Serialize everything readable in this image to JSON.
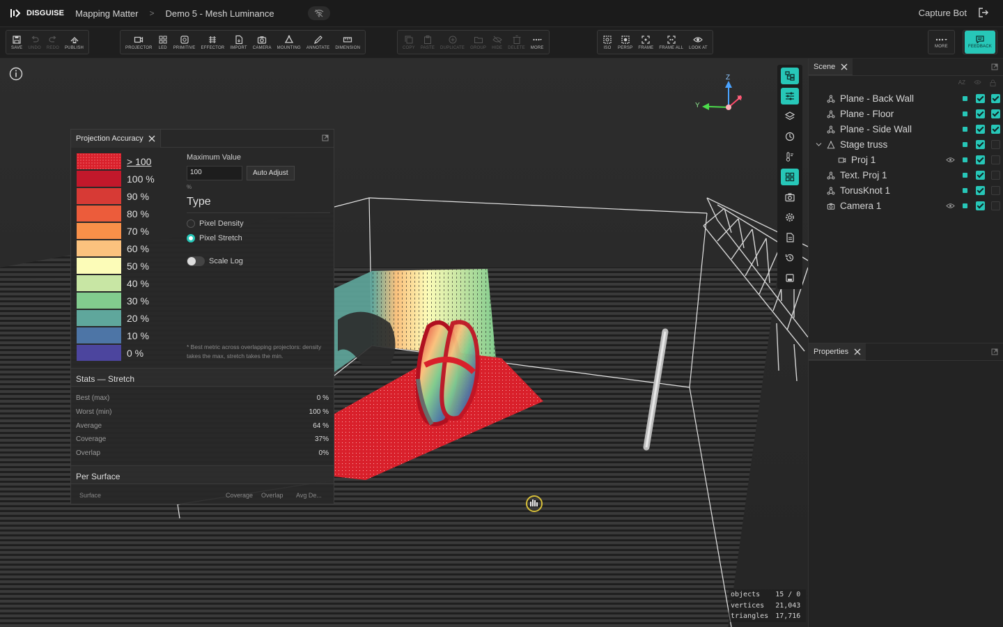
{
  "topbar": {
    "brand": "DISGUISE",
    "project": "Mapping Matter",
    "separator": ">",
    "scene_name": "Demo 5 - Mesh Luminance",
    "user": "Capture Bot"
  },
  "toolbar": {
    "groups": [
      [
        {
          "label": "SAVE",
          "icon": "save-icon",
          "enabled": true
        },
        {
          "label": "UNDO",
          "icon": "undo-icon",
          "enabled": false
        },
        {
          "label": "REDO",
          "icon": "redo-icon",
          "enabled": false
        },
        {
          "label": "PUBLISH",
          "icon": "publish-icon",
          "enabled": true
        }
      ],
      [
        {
          "label": "PROJECTOR",
          "icon": "projector-icon",
          "enabled": true
        },
        {
          "label": "LED",
          "icon": "led-icon",
          "enabled": true
        },
        {
          "label": "PRIMITIVE",
          "icon": "primitive-icon",
          "enabled": true
        },
        {
          "label": "EFFECTOR",
          "icon": "effector-icon",
          "enabled": true
        },
        {
          "label": "IMPORT",
          "icon": "import-icon",
          "enabled": true
        },
        {
          "label": "CAMERA",
          "icon": "camera-icon",
          "enabled": true
        },
        {
          "label": "MOUNTING",
          "icon": "mounting-icon",
          "enabled": true
        },
        {
          "label": "ANNOTATE",
          "icon": "annotate-icon",
          "enabled": true
        },
        {
          "label": "DIMENSION",
          "icon": "dimension-icon",
          "enabled": true
        }
      ],
      [
        {
          "label": "COPY",
          "icon": "copy-icon",
          "enabled": false
        },
        {
          "label": "PASTE",
          "icon": "paste-icon",
          "enabled": false
        },
        {
          "label": "DUPLICATE",
          "icon": "duplicate-icon",
          "enabled": false
        },
        {
          "label": "GROUP",
          "icon": "group-icon",
          "enabled": false
        },
        {
          "label": "HIDE",
          "icon": "hide-icon",
          "enabled": false
        },
        {
          "label": "DELETE",
          "icon": "delete-icon",
          "enabled": false
        },
        {
          "label": "MORE",
          "icon": "more-icon",
          "enabled": true
        }
      ],
      [
        {
          "label": "ISO",
          "icon": "iso-icon",
          "enabled": true
        },
        {
          "label": "PERSP",
          "icon": "persp-icon",
          "enabled": true
        },
        {
          "label": "FRAME",
          "icon": "frame-icon",
          "enabled": true
        },
        {
          "label": "FRAME ALL",
          "icon": "frame-all-icon",
          "enabled": true
        },
        {
          "label": "LOOK AT",
          "icon": "look-at-icon",
          "enabled": true
        }
      ]
    ],
    "more_label": "MORE",
    "feedback_label": "FEEDBACK"
  },
  "viewport": {
    "axes": {
      "z": "Z",
      "y": "Y",
      "x": "X"
    },
    "stats": [
      {
        "key": "objects",
        "value": "15 / 0"
      },
      {
        "key": "vertices",
        "value": "21,043"
      },
      {
        "key": "triangles",
        "value": "17,716"
      }
    ]
  },
  "projection_panel": {
    "title": "Projection Accuracy",
    "legend": [
      {
        "label": "> 100",
        "color": "#d9202b"
      },
      {
        "label": "100 %",
        "color": "#c2182b"
      },
      {
        "label": "90 %",
        "color": "#d73a35"
      },
      {
        "label": "80 %",
        "color": "#ec5c3b"
      },
      {
        "label": "70 %",
        "color": "#f99049"
      },
      {
        "label": "60 %",
        "color": "#fbc27e"
      },
      {
        "label": "50 %",
        "color": "#fcfcb8"
      },
      {
        "label": "40 %",
        "color": "#c8e6a4"
      },
      {
        "label": "30 %",
        "color": "#82cc8e"
      },
      {
        "label": "20 %",
        "color": "#5fa79c"
      },
      {
        "label": "10 %",
        "color": "#4d75a6"
      },
      {
        "label": "0 %",
        "color": "#4c459e"
      }
    ],
    "max_value_label": "Maximum Value",
    "max_value": "100",
    "auto_adjust_label": "Auto Adjust",
    "unit": "%",
    "type_heading": "Type",
    "types": [
      {
        "label": "Pixel Density",
        "selected": false
      },
      {
        "label": "Pixel Stretch",
        "selected": true
      }
    ],
    "scale_log_label": "Scale Log",
    "note": "* Best metric across overlapping projectors: density takes the max, stretch takes the min.",
    "stats_heading": "Stats — Stretch",
    "stats": [
      {
        "label": "Best (max)",
        "value": "0 %"
      },
      {
        "label": "Worst (min)",
        "value": "100 %"
      },
      {
        "label": "Average",
        "value": "64 %"
      },
      {
        "label": "Coverage",
        "value": "37%"
      },
      {
        "label": "Overlap",
        "value": "0%"
      }
    ],
    "per_surface_heading": "Per Surface",
    "columns": [
      "Surface",
      "Coverage",
      "Overlap",
      "Avg De..."
    ]
  },
  "scene_panel": {
    "title": "Scene",
    "sort_label": "AZ",
    "items": [
      {
        "label": "Plane - Back Wall",
        "icon": "mesh-icon",
        "indent": 0,
        "eye": false,
        "vis": true,
        "lock": true
      },
      {
        "label": "Plane - Floor",
        "icon": "mesh-icon",
        "indent": 0,
        "eye": false,
        "vis": true,
        "lock": true
      },
      {
        "label": "Plane - Side Wall",
        "icon": "mesh-icon",
        "indent": 0,
        "eye": false,
        "vis": true,
        "lock": true
      },
      {
        "label": "Stage truss",
        "icon": "truss-icon",
        "indent": 0,
        "eye": false,
        "vis": true,
        "lock": false,
        "expanded": true
      },
      {
        "label": "Proj 1",
        "icon": "projector-icon",
        "indent": 1,
        "eye": true,
        "vis": true,
        "lock": false
      },
      {
        "label": "Text. Proj 1",
        "icon": "mesh-icon",
        "indent": 0,
        "eye": false,
        "vis": true,
        "lock": false
      },
      {
        "label": "TorusKnot 1",
        "icon": "mesh-icon",
        "indent": 0,
        "eye": false,
        "vis": true,
        "lock": false
      },
      {
        "label": "Camera 1",
        "icon": "camera-icon",
        "indent": 0,
        "eye": true,
        "vis": true,
        "lock": false
      }
    ]
  },
  "properties_panel": {
    "title": "Properties"
  },
  "colors": {
    "accent": "#27c7b8",
    "background": "#1c1c1c",
    "panel": "#232323"
  }
}
